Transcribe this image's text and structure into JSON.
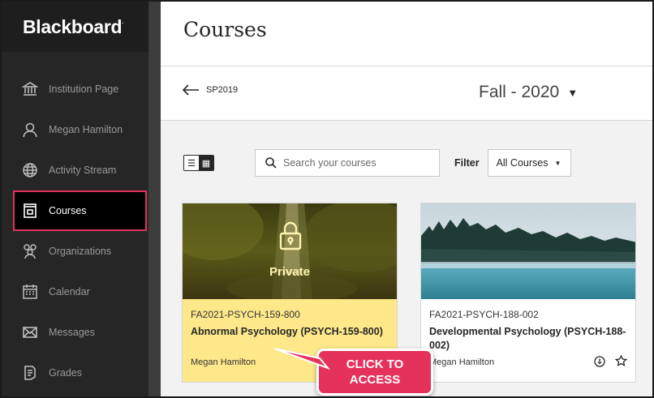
{
  "brand": {
    "name": "Blackboard",
    "mark": "."
  },
  "sidebar": {
    "items": [
      {
        "label": "Institution Page",
        "icon": "institution-icon"
      },
      {
        "label": "Megan Hamilton",
        "icon": "user-icon"
      },
      {
        "label": "Activity Stream",
        "icon": "globe-icon"
      },
      {
        "label": "Courses",
        "icon": "courses-icon",
        "active": true
      },
      {
        "label": "Organizations",
        "icon": "organizations-icon"
      },
      {
        "label": "Calendar",
        "icon": "calendar-icon"
      },
      {
        "label": "Messages",
        "icon": "envelope-icon"
      },
      {
        "label": "Grades",
        "icon": "grades-icon"
      }
    ]
  },
  "header": {
    "title": "Courses"
  },
  "term": {
    "back_label": "SP2019",
    "current": "Fall - 2020"
  },
  "controls": {
    "search_placeholder": "Search your courses",
    "filter_label": "Filter",
    "filter_value": "All Courses"
  },
  "courses": [
    {
      "id": "FA2021-PSYCH-159-800",
      "name": "Abnormal Psychology (PSYCH-159-800)",
      "instructor": "Megan Hamilton",
      "status": "Private"
    },
    {
      "id": "FA2021-PSYCH-188-002",
      "name": "Developmental Psychology (PSYCH-188-002)",
      "instructor": "Megan Hamilton"
    }
  ],
  "callout": {
    "line1": "CLICK TO",
    "line2": "ACCESS"
  },
  "colors": {
    "accent": "#e4325c",
    "sidebar": "#262626",
    "private_card": "#ffe88a"
  }
}
